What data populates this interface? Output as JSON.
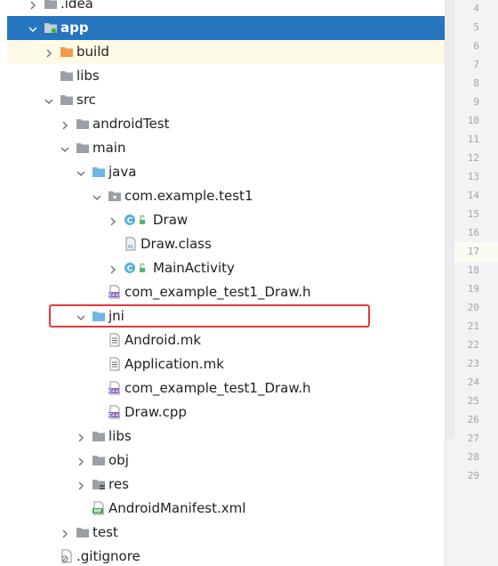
{
  "tree": [
    {
      "label": ".idea",
      "indent": 0,
      "arrow": "right",
      "icon": "folder-gray-icon"
    },
    {
      "label": "app",
      "indent": 0,
      "arrow": "down",
      "icon": "module-folder-icon",
      "selected": true
    },
    {
      "label": "build",
      "indent": 1,
      "arrow": "right",
      "icon": "folder-orange-icon",
      "highlighted": true
    },
    {
      "label": "libs",
      "indent": 1,
      "arrow": "none",
      "icon": "folder-gray-icon"
    },
    {
      "label": "src",
      "indent": 1,
      "arrow": "down",
      "icon": "folder-gray-icon"
    },
    {
      "label": "androidTest",
      "indent": 2,
      "arrow": "right",
      "icon": "folder-gray-icon"
    },
    {
      "label": "main",
      "indent": 2,
      "arrow": "down",
      "icon": "folder-gray-icon"
    },
    {
      "label": "java",
      "indent": 3,
      "arrow": "down",
      "icon": "folder-blue-icon"
    },
    {
      "label": "com.example.test1",
      "indent": 4,
      "arrow": "down",
      "icon": "package-icon"
    },
    {
      "label": "Draw",
      "indent": 5,
      "arrow": "right",
      "icon": "class-icon"
    },
    {
      "label": "Draw.class",
      "indent": 5,
      "arrow": "none",
      "icon": "binary-file-icon"
    },
    {
      "label": "MainActivity",
      "indent": 5,
      "arrow": "right",
      "icon": "class-icon"
    },
    {
      "label": "com_example_test1_Draw.h",
      "indent": 4,
      "arrow": "none",
      "icon": "cpp-file-icon"
    },
    {
      "label": "jni",
      "indent": 3,
      "arrow": "down",
      "icon": "folder-blue-icon"
    },
    {
      "label": "Android.mk",
      "indent": 4,
      "arrow": "none",
      "icon": "text-file-icon"
    },
    {
      "label": "Application.mk",
      "indent": 4,
      "arrow": "none",
      "icon": "text-file-icon"
    },
    {
      "label": "com_example_test1_Draw.h",
      "indent": 4,
      "arrow": "none",
      "icon": "cpp-file-icon"
    },
    {
      "label": "Draw.cpp",
      "indent": 4,
      "arrow": "none",
      "icon": "cpp-file-icon"
    },
    {
      "label": "libs",
      "indent": 3,
      "arrow": "right",
      "icon": "folder-gray-icon"
    },
    {
      "label": "obj",
      "indent": 3,
      "arrow": "right",
      "icon": "folder-gray-icon"
    },
    {
      "label": "res",
      "indent": 3,
      "arrow": "right",
      "icon": "res-folder-icon"
    },
    {
      "label": "AndroidManifest.xml",
      "indent": 3,
      "arrow": "none",
      "icon": "manifest-file-icon"
    },
    {
      "label": "test",
      "indent": 2,
      "arrow": "right",
      "icon": "folder-gray-icon"
    },
    {
      "label": ".gitignore",
      "indent": 1,
      "arrow": "none",
      "icon": "gitignore-file-icon"
    }
  ],
  "gutter": {
    "line_numbers": [
      "4",
      "5",
      "6",
      "7",
      "8",
      "9",
      "10",
      "11",
      "12",
      "13",
      "14",
      "15",
      "16",
      "17",
      "18",
      "19",
      "20",
      "21",
      "22",
      "23",
      "24",
      "25",
      "26",
      "27",
      "28",
      "29"
    ],
    "current_line": "17"
  },
  "colors": {
    "selection": "#2675bf",
    "highlight_row": "#fdfbe6",
    "annotation_box": "#e8383d",
    "folder_gray": "#9aa0a6",
    "folder_blue": "#6fb6e6",
    "folder_orange": "#f29b4c"
  }
}
